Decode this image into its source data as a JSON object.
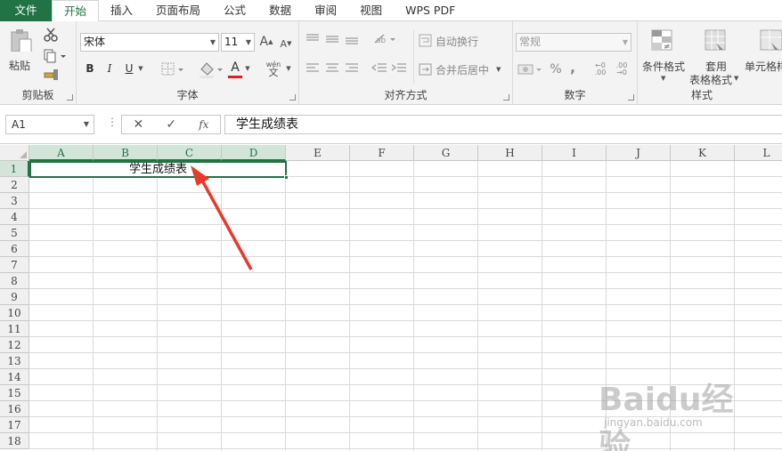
{
  "tabs": [
    "文件",
    "开始",
    "插入",
    "页面布局",
    "公式",
    "数据",
    "审阅",
    "视图",
    "WPS PDF"
  ],
  "active_tab": "开始",
  "ribbon": {
    "clipboard": {
      "paste_label": "粘贴",
      "group_label": "剪贴板"
    },
    "font": {
      "font_name": "宋体",
      "font_size": "11",
      "grow_label": "A",
      "shrink_label": "A",
      "bold": "B",
      "italic": "I",
      "underline": "U",
      "font_color_label": "A",
      "phonetic_top": "wén",
      "phonetic_bottom": "文",
      "group_label": "字体"
    },
    "alignment": {
      "wrap_label": "自动换行",
      "merge_label": "合并后居中",
      "group_label": "对齐方式"
    },
    "number": {
      "format": "常规",
      "percent": "%",
      "comma": ",",
      "inc_decimal": ".00",
      "dec_decimal": ".00",
      "group_label": "数字"
    },
    "styles": {
      "conditional_label": "条件格式",
      "table_label_1": "套用",
      "table_label_2": "表格格式",
      "cell_label": "单元格样",
      "group_label": "样式"
    }
  },
  "formula_bar": {
    "name_box": "A1",
    "cancel": "✕",
    "enter": "✓",
    "fx": "fx",
    "content": "学生成绩表"
  },
  "sheet": {
    "columns": [
      "A",
      "B",
      "C",
      "D",
      "E",
      "F",
      "G",
      "H",
      "I",
      "J",
      "K",
      "L"
    ],
    "selected_columns": [
      "A",
      "B",
      "C",
      "D"
    ],
    "rows": [
      "1",
      "2",
      "3",
      "4",
      "5",
      "6",
      "7",
      "8",
      "9",
      "10",
      "11",
      "12",
      "13",
      "14",
      "15",
      "16",
      "17",
      "18"
    ],
    "selected_row": "1",
    "merged_cell_text": "学生成绩表"
  },
  "watermark": {
    "logo": "Baidu经验",
    "url": "jingyan.baidu.com"
  },
  "colors": {
    "accent": "#217346",
    "arrow": "#e8392a"
  }
}
